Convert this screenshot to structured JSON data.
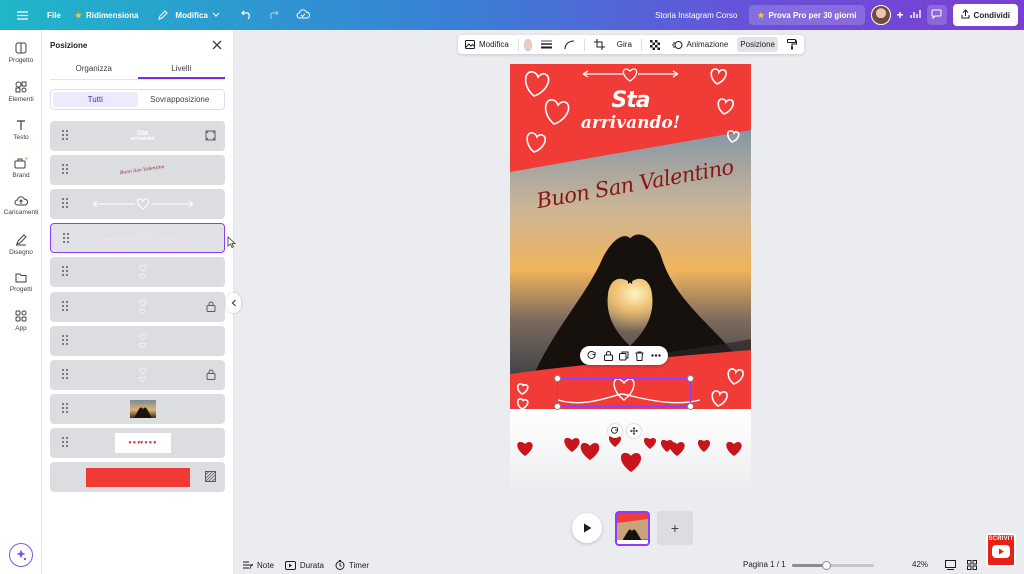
{
  "topbar": {
    "file": "File",
    "resize": "Ridimensiona",
    "edit": "Modifica",
    "doc_title": "Storia Instagram Corso",
    "pro": "Prova Pro per 30 giorni",
    "share": "Condividi"
  },
  "rail": [
    "Progetto",
    "Elementi",
    "Testo",
    "Brand",
    "Caricamenti",
    "Disegno",
    "Progetti",
    "App"
  ],
  "panel": {
    "title": "Posizione",
    "tabs": [
      "Organizza",
      "Livelli"
    ],
    "active_tab": "Livelli",
    "filters": [
      "Tutti",
      "Sovrapposizione"
    ],
    "active_filter": "Tutti",
    "layers": [
      {
        "thumb": "text-title",
        "text_line1": "Sta",
        "text_line2": "arrivando!",
        "end": "grid-icon"
      },
      {
        "thumb": "script-text",
        "text": "Buon San Valentino",
        "end": ""
      },
      {
        "thumb": "arrow-heart",
        "end": ""
      },
      {
        "thumb": "faint",
        "selected": true,
        "end": ""
      },
      {
        "thumb": "hearts-doodle",
        "end": ""
      },
      {
        "thumb": "hearts-doodle",
        "end": "lock-icon"
      },
      {
        "thumb": "hearts-doodle",
        "end": ""
      },
      {
        "thumb": "hearts-doodle",
        "end": "lock-icon"
      },
      {
        "thumb": "photo",
        "end": ""
      },
      {
        "thumb": "hearts-row",
        "end": ""
      },
      {
        "thumb": "red-rect",
        "end": "transparency-icon"
      }
    ]
  },
  "context_toolbar": {
    "edit": "Modifica",
    "color": "#f5c9c2",
    "flip": "Gira",
    "animation": "Animazione",
    "position": "Posizione"
  },
  "canvas": {
    "headline1": "Sta",
    "headline2": "arrivando!",
    "script": "Buon San Valentino",
    "bg_red": "#f03b37"
  },
  "bottombar": {
    "notes": "Note",
    "duration": "Durata",
    "timer": "Timer",
    "page": "Pagina 1 / 1",
    "zoom": "42%",
    "zoom_level": 0.42
  },
  "badge": "ISCRIVITI"
}
